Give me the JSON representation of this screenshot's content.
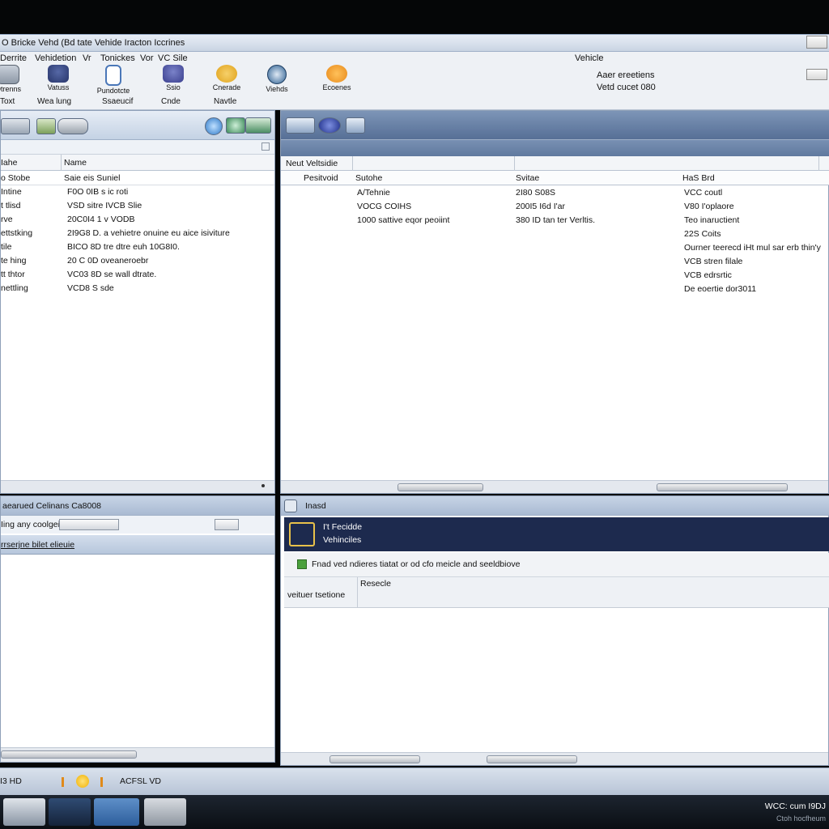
{
  "window": {
    "title": "O Bricke Vehd (Bd tate Vehide Iracton Iccrines"
  },
  "menu": {
    "items": [
      "Derrite",
      "Vehidetion",
      "Vr",
      "Tonickes",
      "Vor",
      "VC Sile"
    ],
    "vehicle_label": "Vehicle"
  },
  "toolbar": {
    "tools": [
      {
        "label": "Otrenns",
        "icon": "device-icon",
        "color": "#8d98a6"
      },
      {
        "label": "Vatuss",
        "icon": "car-icon",
        "color": "#27356a"
      },
      {
        "label": "Pundotcte",
        "icon": "clipboard-icon",
        "color": "#4a77b8"
      },
      {
        "label": "Ssio",
        "icon": "car-front-icon",
        "color": "#3a3f8e"
      },
      {
        "label": "Cnerade",
        "icon": "gears-icon",
        "color": "#e0a21b"
      },
      {
        "label": "Viehds",
        "icon": "gauge-icon",
        "color": "#2c5f92"
      },
      {
        "label": "Ecoenes",
        "icon": "engine-icon",
        "color": "#e88a1b"
      }
    ],
    "sublabels": [
      "Toxt",
      "Wea lung",
      "Ssaeucif",
      "Cnde",
      "Navtle"
    ],
    "info_lines": [
      "Aaer ereetiens",
      "Vetd cucet 080"
    ]
  },
  "left_pane": {
    "columns": [
      "Iahe",
      "Name"
    ],
    "rows": [
      [
        "o Stobe",
        "Saie eis Suniel"
      ],
      [
        "Intine",
        "F0O 0IB s ic roti"
      ],
      [
        "t tlisd",
        "VSD sitre IVCB Slie"
      ],
      [
        "rve",
        "20C0I4 1 v VODB"
      ],
      [
        "ettstking",
        "2I9G8 D. a vehietre onuine eu aice isiviture"
      ],
      [
        "tile",
        "BICO 8D tre dtre euh 10G8I0."
      ],
      [
        "te hing",
        "20 C 0D oveaneroebr"
      ],
      [
        "tt thtor",
        "VC03 8D se wall dtrate."
      ],
      [
        "nettling",
        "VCD8 S sde"
      ]
    ]
  },
  "right_pane": {
    "section_title": "Neut Veltsidie",
    "columns": [
      "Pesitvoid",
      "Sutohe",
      "Svitae",
      "HaS Brd"
    ],
    "rows": [
      [
        "",
        "A/Tehnie",
        "2I80 S08S",
        "VCC coutl"
      ],
      [
        "",
        "VOCG COIHS",
        "200I5 I6d I'ar",
        "V80 I'oplaore"
      ],
      [
        "",
        "1000 sattive eqor peoiint",
        "380 ID tan ter Verltis.",
        "Teo inaructient"
      ],
      [
        "",
        "",
        "",
        "22S Coits"
      ],
      [
        "",
        "",
        "",
        "Ourner teerecd iHt mul sar erb thin'y"
      ],
      [
        "",
        "",
        "",
        "VCB stren filale"
      ],
      [
        "",
        "",
        "",
        "VCB edrsrtic"
      ],
      [
        "",
        "",
        "",
        "De eoertie dor3011"
      ]
    ]
  },
  "bottom_left": {
    "title": "aearued Celinans Ca8008",
    "filter_label": "Iing any coolgeis",
    "header": "rrserjne bilet elieuie"
  },
  "bottom_right": {
    "title": "Inasd",
    "banner_line1": "I't Fecidde",
    "banner_line2": "Vehinciles",
    "message": "Fnad ved ndieres tiatat or od cfo meicle and seeldbiove",
    "field_label": "Resecle",
    "selection_label": "veituer tsetione"
  },
  "statusbar": {
    "left_text": "I3 HD",
    "center_text": "ACFSL VD"
  },
  "taskbar": {
    "clock_line1": "WCC: cum I9DJ",
    "clock_line2": "Ctoh hocfheum"
  }
}
